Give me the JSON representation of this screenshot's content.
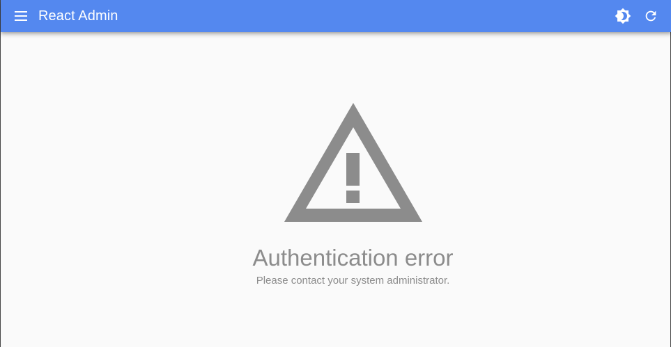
{
  "appbar": {
    "title": "React Admin",
    "background_color": "#5488ef",
    "menu_icon": "hamburger-menu-icon",
    "theme_toggle_icon": "brightness-icon",
    "refresh_icon": "refresh-icon"
  },
  "error": {
    "icon": "warning-triangle-icon",
    "icon_color": "#8c8c8c",
    "title": "Authentication error",
    "message": "Please contact your system administrator."
  }
}
